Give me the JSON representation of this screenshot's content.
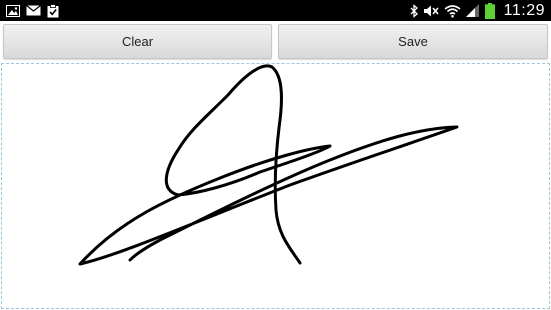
{
  "status_bar": {
    "time": "11:29",
    "left_icons": [
      "gallery-icon",
      "mail-icon",
      "clipboard-check-icon"
    ],
    "right_icons": [
      "bluetooth-icon",
      "mute-icon",
      "wifi-icon",
      "signal-icon",
      "battery-icon"
    ]
  },
  "toolbar": {
    "clear_label": "Clear",
    "save_label": "Save"
  },
  "colors": {
    "status_bar_bg": "#000000",
    "battery_fill": "#5fcf36",
    "pad_border": "#9bc6dc",
    "ink": "#000000"
  }
}
